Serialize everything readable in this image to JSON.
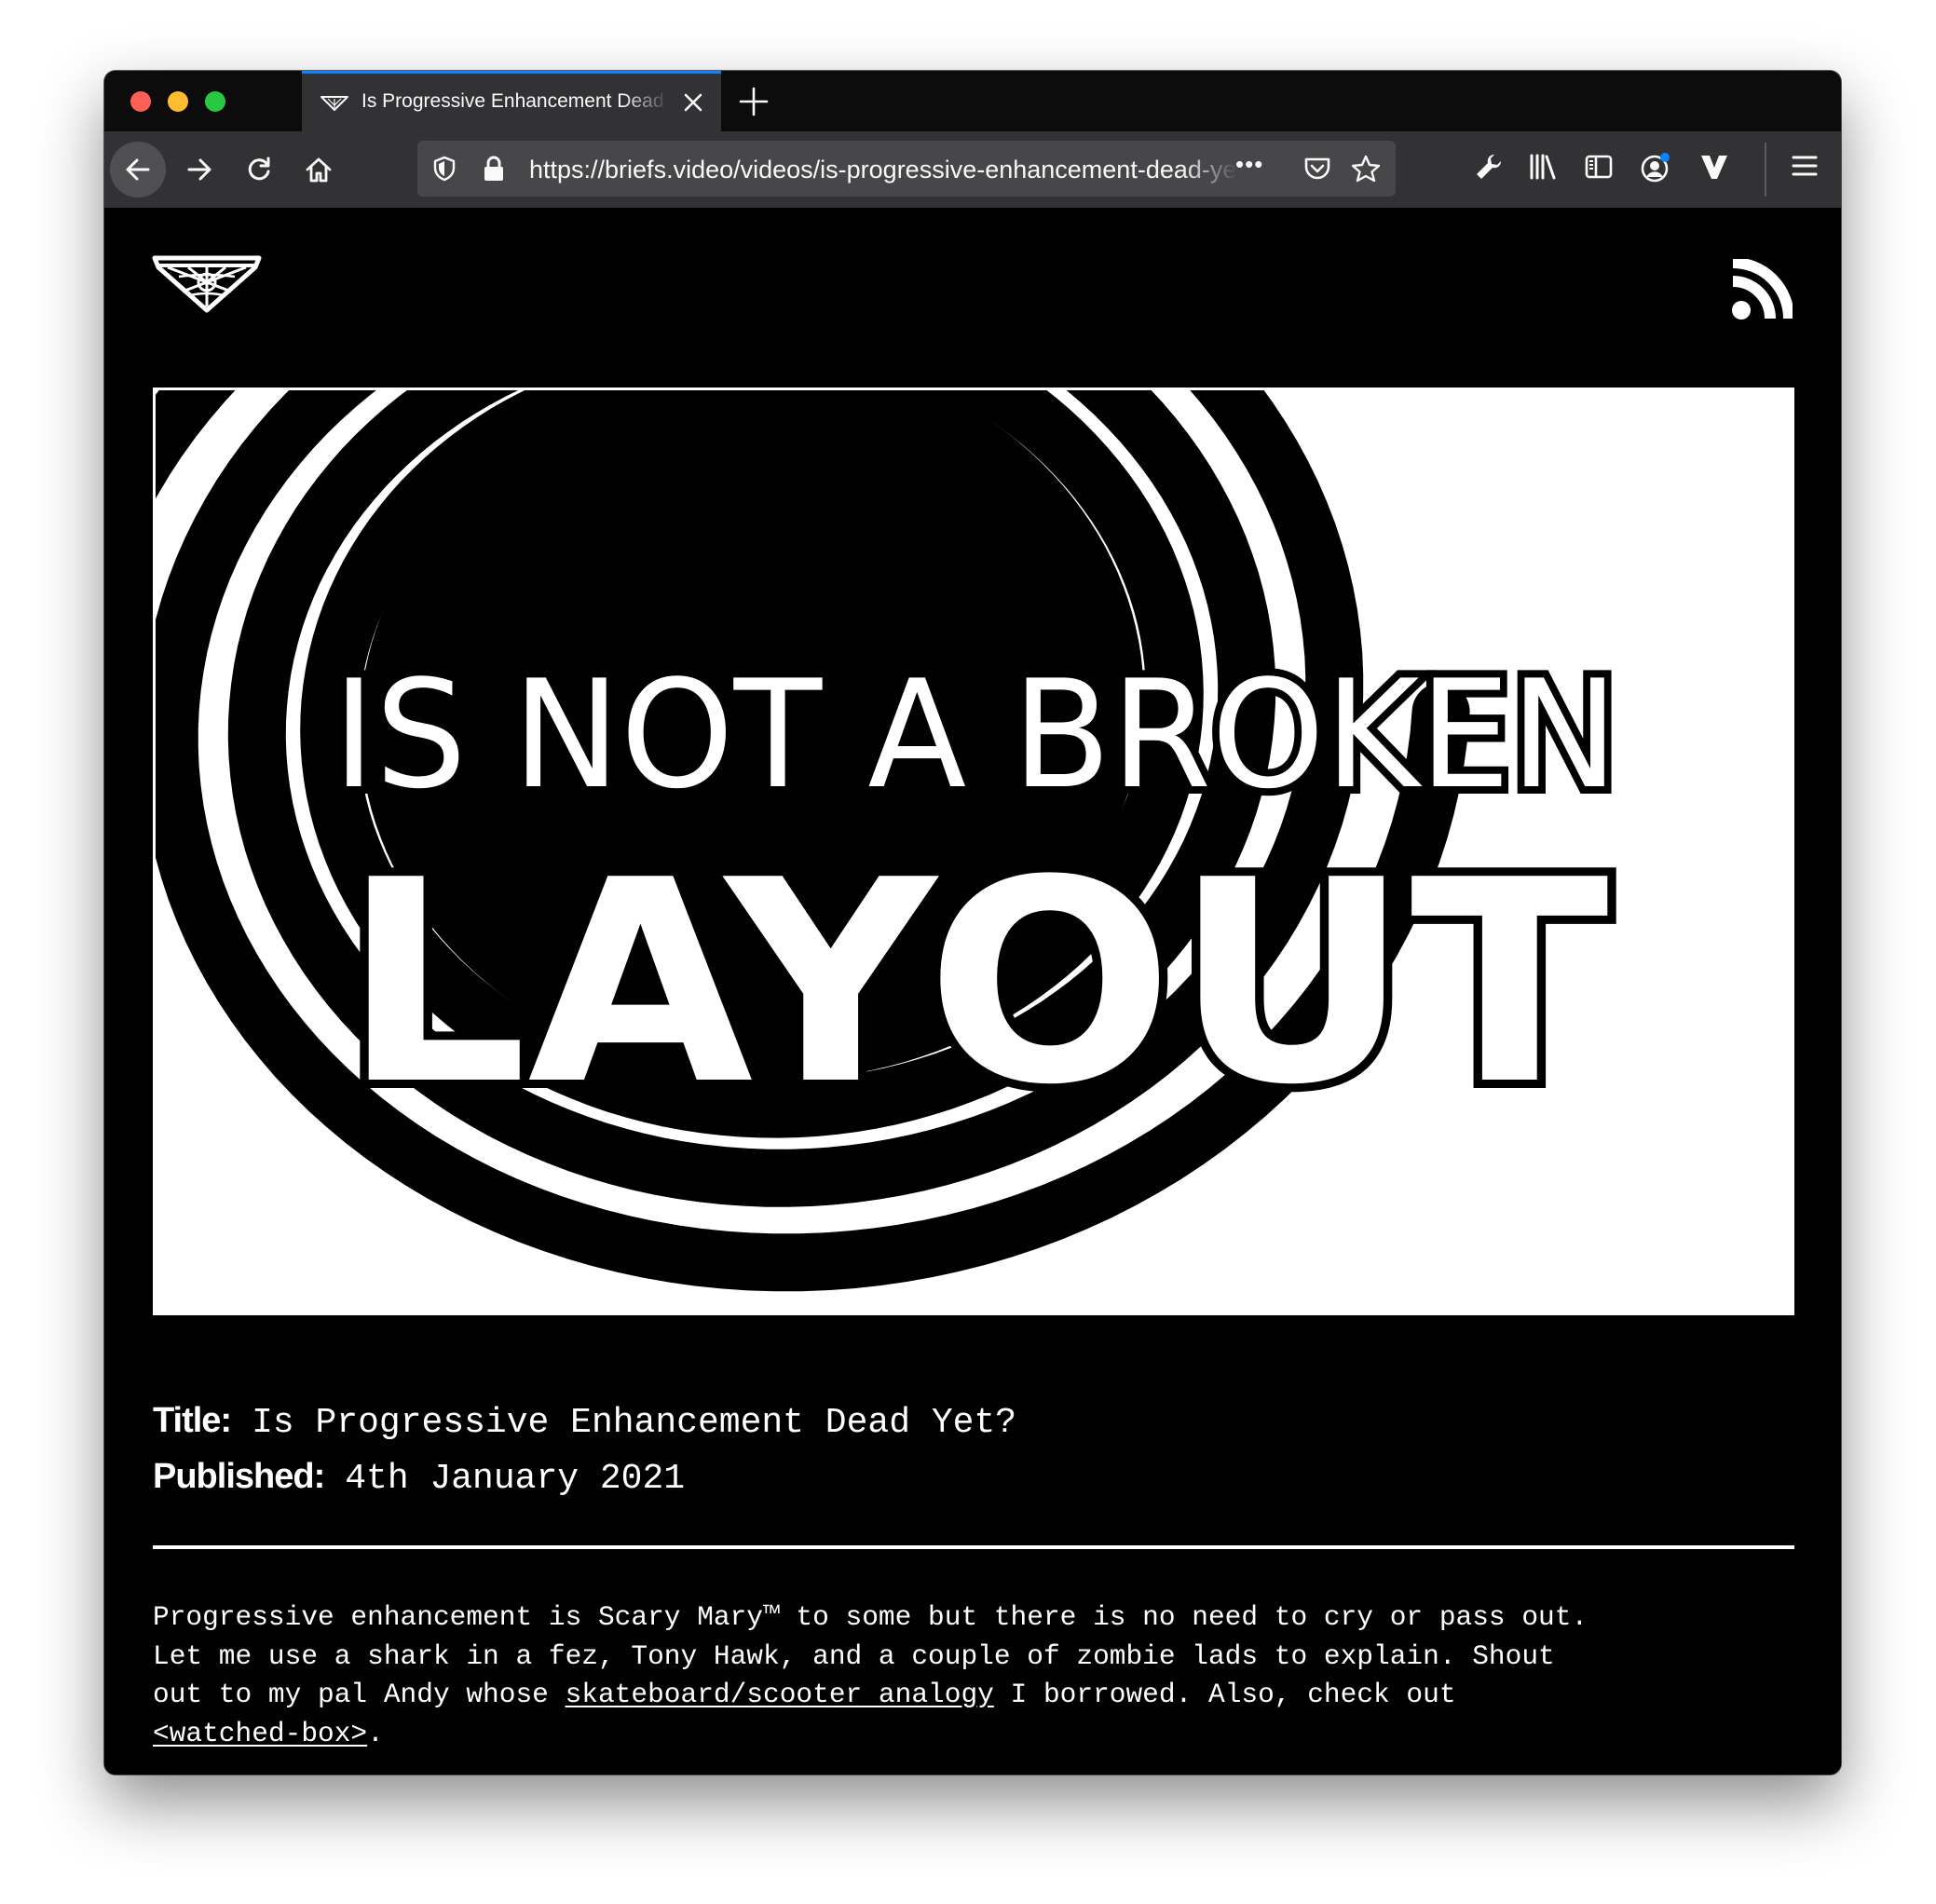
{
  "browser": {
    "tab_title": "Is Progressive Enhancement Dead Yet?",
    "url": "https://briefs.video/videos/is-progressive-enhancement-dead-yet/",
    "page_actions_label": "•••"
  },
  "site": {
    "logo_icon": "briefs-logo-icon",
    "feed_icon": "rss-icon"
  },
  "hero": {
    "line1": "IS NOT A BROKEN",
    "line2": "LAYOUT"
  },
  "meta": {
    "title_label": "Title:",
    "title_value": "Is Progressive Enhancement Dead Yet?",
    "published_label": "Published:",
    "published_value": "4th January 2021"
  },
  "description": {
    "line1": "Progressive enhancement is Scary Mary™ to some but there is no need to cry or pass out.",
    "line2": "Let me use a shark in a fez, Tony Hawk, and a couple of zombie lads to explain. Shout",
    "line3_before": "out to my pal Andy whose ",
    "link1": "skateboard/scooter analogy",
    "line3_after": " I borrowed. Also, check out",
    "link2": "<watched-box>",
    "line4_after": "."
  },
  "colors": {
    "page_bg": "#000000",
    "text": "#ffffff",
    "tab_accent": "#0a84ff"
  }
}
